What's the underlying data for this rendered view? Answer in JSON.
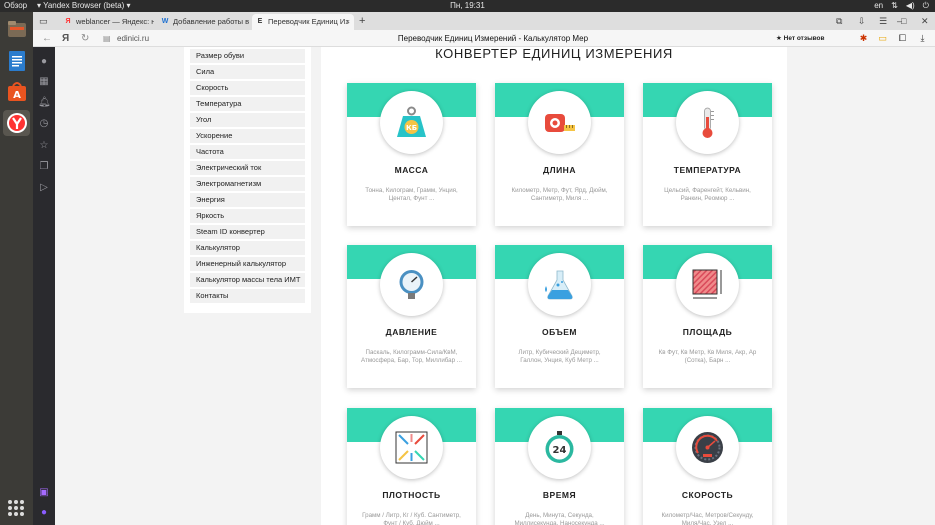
{
  "system": {
    "activities": "Обзор",
    "app_name": "Yandex Browser (beta)",
    "clock": "Пн, 19:31",
    "lang": "en"
  },
  "tabs": [
    {
      "label": "weblancer — Яндекс: нашл",
      "fav": "Я",
      "fav_color": "#ff3333"
    },
    {
      "label": "Добавление работы в по",
      "fav": "W",
      "fav_color": "#1a6fd1"
    },
    {
      "label": "Переводчик Единиц Из",
      "fav": "E",
      "fav_color": "#333333"
    }
  ],
  "address": {
    "url": "edinici.ru",
    "title": "Переводчик Единиц Измерений - Калькулятор Мер",
    "reviews": "★ Нет отзывов"
  },
  "sidebar": {
    "items": [
      "Размер обуви",
      "Сила",
      "Скорость",
      "Температура",
      "Угол",
      "Ускорение",
      "Частота",
      "Электрический ток",
      "Электромагнетизм",
      "Энергия",
      "Яркость",
      "Steam ID конвертер",
      "Калькулятор",
      "Инженерный калькулятор",
      "Калькулятор массы тела ИМТ",
      "Контакты"
    ]
  },
  "main": {
    "heading": "КОНВЕРТЕР ЕДИНИЦ ИЗМЕРЕНИЯ",
    "cards": [
      {
        "title": "МАССА",
        "desc": "Тонна, Килограм, Грамм, Унция, Центал, Фунт ...",
        "icon": "weight-icon"
      },
      {
        "title": "ДЛИНА",
        "desc": "Километр, Метр, Фут, Ярд, Дюйм, Сантиметр, Миля ...",
        "icon": "tape-measure-icon"
      },
      {
        "title": "ТЕМПЕРАТУРА",
        "desc": "Цельсий, Фаренгейт, Кельвин, Ранкин, Реомюр ...",
        "icon": "thermometer-icon"
      },
      {
        "title": "ДАВЛЕНИЕ",
        "desc": "Паскаль, Килограмм-Сила/КвМ, Атмосфера, Бар, Тор, Миллибар ...",
        "icon": "pressure-gauge-icon"
      },
      {
        "title": "ОБЪЕМ",
        "desc": "Литр, Кубический Дециметр, Галлон, Унция, Куб Метр ...",
        "icon": "flask-icon"
      },
      {
        "title": "ПЛОЩАДЬ",
        "desc": "Кв Фут, Кв Метр, Кв Миля, Акр, Ар (Сотка), Барн ...",
        "icon": "area-icon"
      },
      {
        "title": "ПЛОТНОСТЬ",
        "desc": "Грамм / Литр, Кг / Куб. Сантиметр, Фунт / Куб. Дюйм ...",
        "icon": "density-icon"
      },
      {
        "title": "ВРЕМЯ",
        "desc": "День, Минута, Секунда, Миллисекунда, Наносекунда ...",
        "icon": "stopwatch-icon"
      },
      {
        "title": "СКОРОСТЬ",
        "desc": "Километр/Час, Метров/Секунду, Миля/Час, Узел ...",
        "icon": "speedometer-icon"
      }
    ],
    "stopwatch_label": "24",
    "weight_label": "КБ"
  },
  "colors": {
    "accent": "#35d6b2",
    "dock": "#3c3b37",
    "topbar": "#2b2b2b"
  }
}
